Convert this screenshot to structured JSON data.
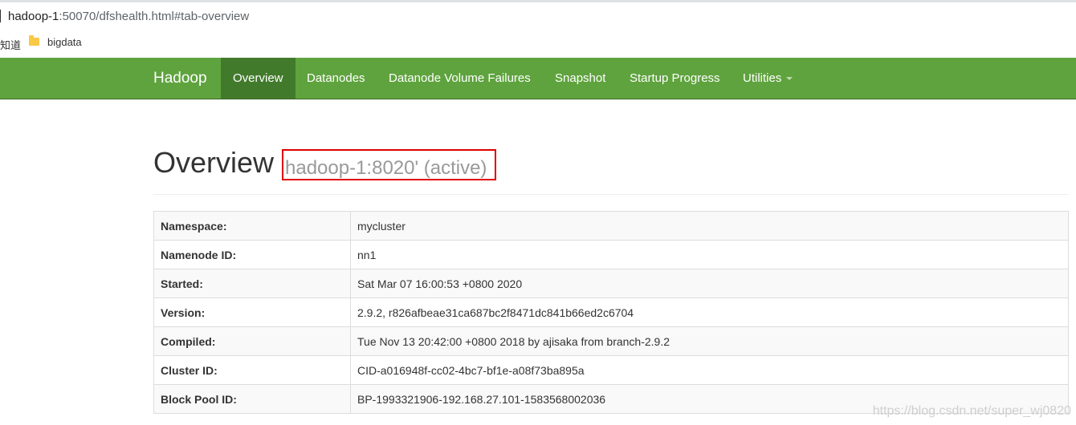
{
  "browser": {
    "url_host": "hadoop-1",
    "url_rest": ":50070/dfshealth.html#tab-overview",
    "bookmark_partial": "知道",
    "bookmark_folder": "bigdata"
  },
  "navbar": {
    "brand": "Hadoop",
    "items": [
      {
        "label": "Overview",
        "active": true
      },
      {
        "label": "Datanodes"
      },
      {
        "label": "Datanode Volume Failures"
      },
      {
        "label": "Snapshot"
      },
      {
        "label": "Startup Progress"
      },
      {
        "label": "Utilities"
      }
    ],
    "color": "#5fa33e",
    "active_color": "#427a2c"
  },
  "header": {
    "title": "Overview",
    "subtitle": "hadoop-1:8020' (active)",
    "highlight_color": "#e00000"
  },
  "overview": {
    "rows": [
      {
        "key": "Namespace:",
        "value": "mycluster"
      },
      {
        "key": "Namenode ID:",
        "value": "nn1"
      },
      {
        "key": "Started:",
        "value": "Sat Mar 07 16:00:53 +0800 2020"
      },
      {
        "key": "Version:",
        "value": "2.9.2, r826afbeae31ca687bc2f8471dc841b66ed2c6704"
      },
      {
        "key": "Compiled:",
        "value": "Tue Nov 13 20:42:00 +0800 2018 by ajisaka from branch-2.9.2"
      },
      {
        "key": "Cluster ID:",
        "value": "CID-a016948f-cc02-4bc7-bf1e-a08f73ba895a"
      },
      {
        "key": "Block Pool ID:",
        "value": "BP-1993321906-192.168.27.101-1583568002036"
      }
    ]
  },
  "watermark": "https://blog.csdn.net/super_wj0820"
}
